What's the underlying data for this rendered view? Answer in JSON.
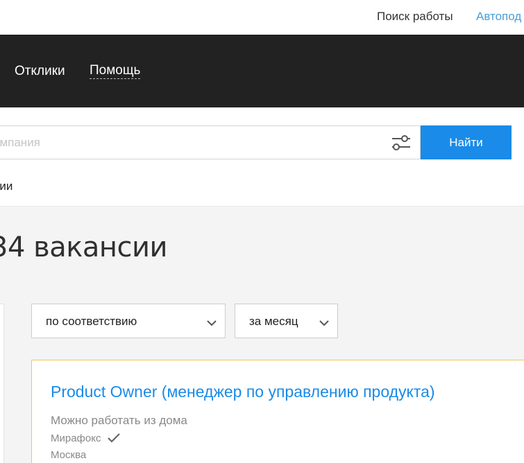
{
  "top_links": {
    "job_search": "Поиск работы",
    "autoselect": "Автопод"
  },
  "nav": {
    "responses": "Отклики",
    "help": "Помощь"
  },
  "search": {
    "placeholder": "омпания",
    "button_label": "Найти"
  },
  "sublink": "нии",
  "results": {
    "title": "34 вакансии"
  },
  "sort": {
    "relevance_value": "по соответствию",
    "period_value": "за месяц"
  },
  "vacancy": {
    "title": "Product Owner (менеджер по управлению продукта)",
    "remote": "Можно работать из дома",
    "company": "Мирафокс",
    "city": "Москва"
  },
  "colors": {
    "accent": "#1a8be8",
    "nav_bg": "#222222",
    "card_border": "#e8c760",
    "link_blue": "#4a9ed6"
  },
  "icons": {
    "filter": "sliders-icon",
    "chevron": "chevron-down-icon",
    "verified": "check-icon"
  }
}
